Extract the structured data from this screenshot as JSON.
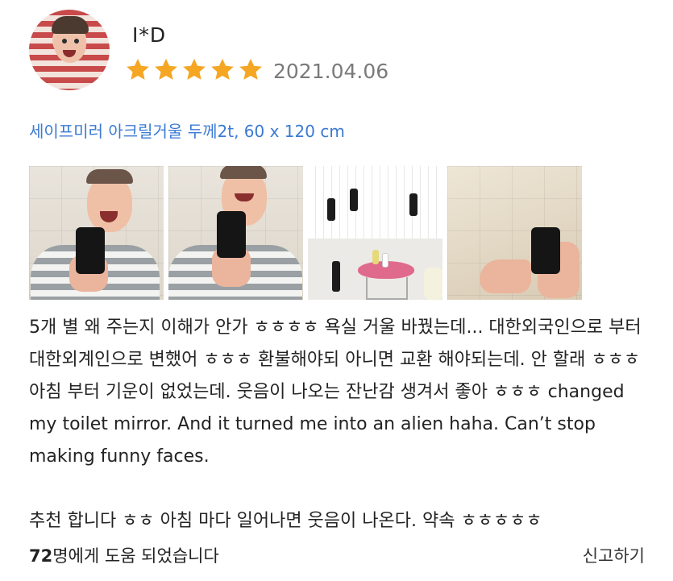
{
  "reviewer": {
    "name": "I*D"
  },
  "rating": {
    "stars": 5,
    "max": 5,
    "star_color": "#F5A623"
  },
  "review_date": "2021.04.06",
  "product": {
    "option_text": "세이프미러 아크릴거울 두께2t, 60 x 120 cm",
    "link_color": "#3B7AD3"
  },
  "photos": [
    {
      "icon": "selfie-photo"
    },
    {
      "icon": "selfie-photo"
    },
    {
      "icon": "bathroom-photo"
    },
    {
      "icon": "mirror-hand-photo"
    }
  ],
  "review": {
    "paragraph_1": "5개 별 왜 주는지 이해가 안가 ㅎㅎㅎㅎ 욕실 거울 바꿨는데... 대한외국인으로 부터 대한외계인으로 변했어 ㅎㅎㅎ 환불해야되 아니면 교환 해야되는데. 안 할래 ㅎㅎㅎ 아침 부터 기운이 없었는데. 웃음이 나오는 잔난감 생겨서 좋아 ㅎㅎㅎ changed my toilet mirror. And it turned me into an alien haha. Can’t stop making funny faces.",
    "paragraph_2": "추천 합니다 ㅎㅎ 아침 마다 일어나면 웃음이 나온다. 약속 ㅎㅎㅎㅎㅎ"
  },
  "footer": {
    "helpful_count": "72",
    "helpful_text": "명에게 도움 되었습니다",
    "report_label": "신고하기"
  }
}
